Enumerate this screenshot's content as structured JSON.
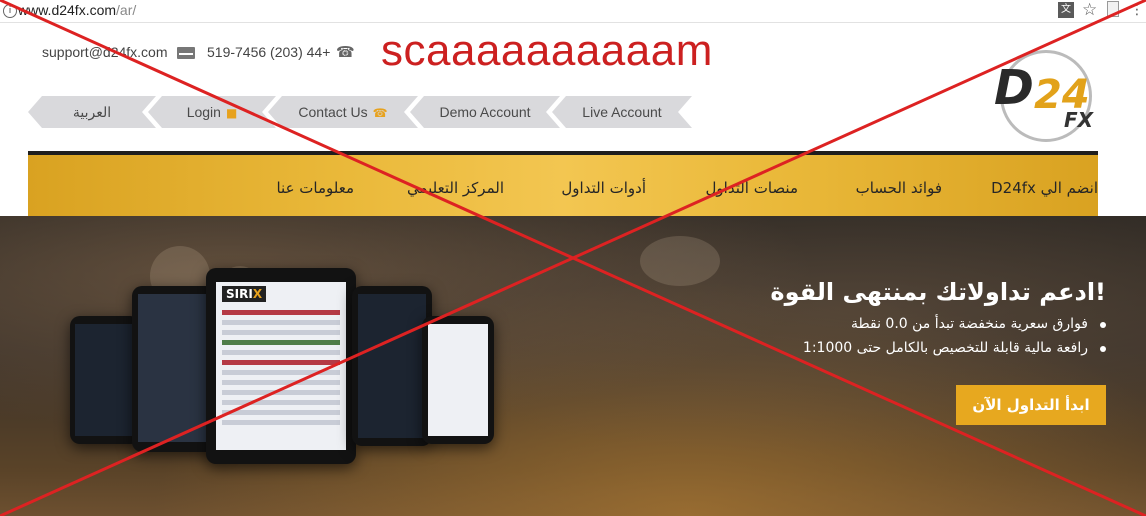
{
  "browser": {
    "url_host": "www.d24fx.com",
    "url_path": "/ar/"
  },
  "contact": {
    "email": "support@d24fx.com",
    "phone": "519-7456 (203) 44+"
  },
  "overlay_text": "scaaaaaaaaaam",
  "logo": {
    "d": "D",
    "num": "24",
    "fx": "FX"
  },
  "top_nav": [
    {
      "label": "العربية"
    },
    {
      "label": "Login"
    },
    {
      "label": "Contact Us"
    },
    {
      "label": "Demo Account"
    },
    {
      "label": "Live Account"
    }
  ],
  "main_menu": [
    {
      "label": "انضم الي D24fx"
    },
    {
      "label": "فوائد الحساب"
    },
    {
      "label": "منصات التداول"
    },
    {
      "label": "أدوات التداول"
    },
    {
      "label": "المركز التعليمي"
    },
    {
      "label": "معلومات عنا"
    }
  ],
  "hero": {
    "title": "!ادعم تداولاتك بمنتهى القوة",
    "bullets": [
      "فوارق سعرية منخفضة تبدأ من 0.0 نقطة",
      "رافعة مالية قابلة للتخصيص بالكامل حتى 1:1000"
    ],
    "cta": "ابدأ التداول الآن",
    "device_brand_a": "SIRI",
    "device_brand_b": "X"
  },
  "colors": {
    "gold": "#e7a81f",
    "cross_red": "#dd2222",
    "nav_grey": "#d9d9dc"
  }
}
